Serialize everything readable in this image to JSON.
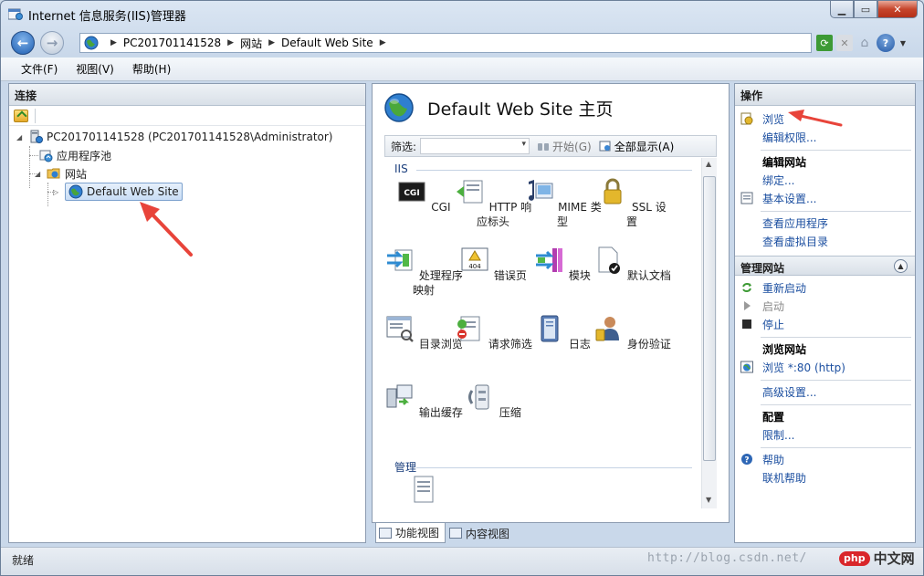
{
  "window": {
    "title": "Internet 信息服务(IIS)管理器"
  },
  "address": {
    "crumbs": [
      "PC201701141528",
      "网站",
      "Default Web Site"
    ]
  },
  "menu": {
    "file": "文件(F)",
    "view": "视图(V)",
    "help": "帮助(H)"
  },
  "left_pane": {
    "header": "连接",
    "tree": {
      "server": "PC201701141528 (PC201701141528\\Administrator)",
      "app_pools": "应用程序池",
      "sites": "网站",
      "default_site": "Default Web Site"
    }
  },
  "center": {
    "title": "Default Web Site 主页",
    "filter_label": "筛选:",
    "start_label": "开始(G)",
    "show_all_label": "全部显示(A)",
    "groups": {
      "iis": "IIS",
      "manage": "管理"
    },
    "features": [
      "CGI",
      "HTTP 响应标头",
      "MIME 类型",
      "SSL 设置",
      "处理程序映射",
      "错误页",
      "模块",
      "默认文档",
      "目录浏览",
      "请求筛选",
      "日志",
      "身份验证",
      "输出缓存",
      "压缩"
    ],
    "view_tabs": {
      "features": "功能视图",
      "content": "内容视图"
    }
  },
  "actions": {
    "header": "操作",
    "browse": "浏览",
    "edit_permissions": "编辑权限...",
    "edit_site_head": "编辑网站",
    "bindings": "绑定...",
    "basic_settings": "基本设置...",
    "view_apps": "查看应用程序",
    "view_vdirs": "查看虚拟目录",
    "manage_site_head": "管理网站",
    "restart": "重新启动",
    "start": "启动",
    "stop": "停止",
    "browse_site_head": "浏览网站",
    "browse_80": "浏览 *:80 (http)",
    "advanced": "高级设置...",
    "config_head": "配置",
    "limits": "限制...",
    "help": "帮助",
    "online_help": "联机帮助"
  },
  "status": {
    "text": "就绪",
    "watermark": "http://blog.csdn.net/",
    "logo_badge": "php",
    "logo_text": "中文网"
  },
  "colors": {
    "link": "#1c4fa0",
    "annotation_arrow": "#e8443a"
  }
}
